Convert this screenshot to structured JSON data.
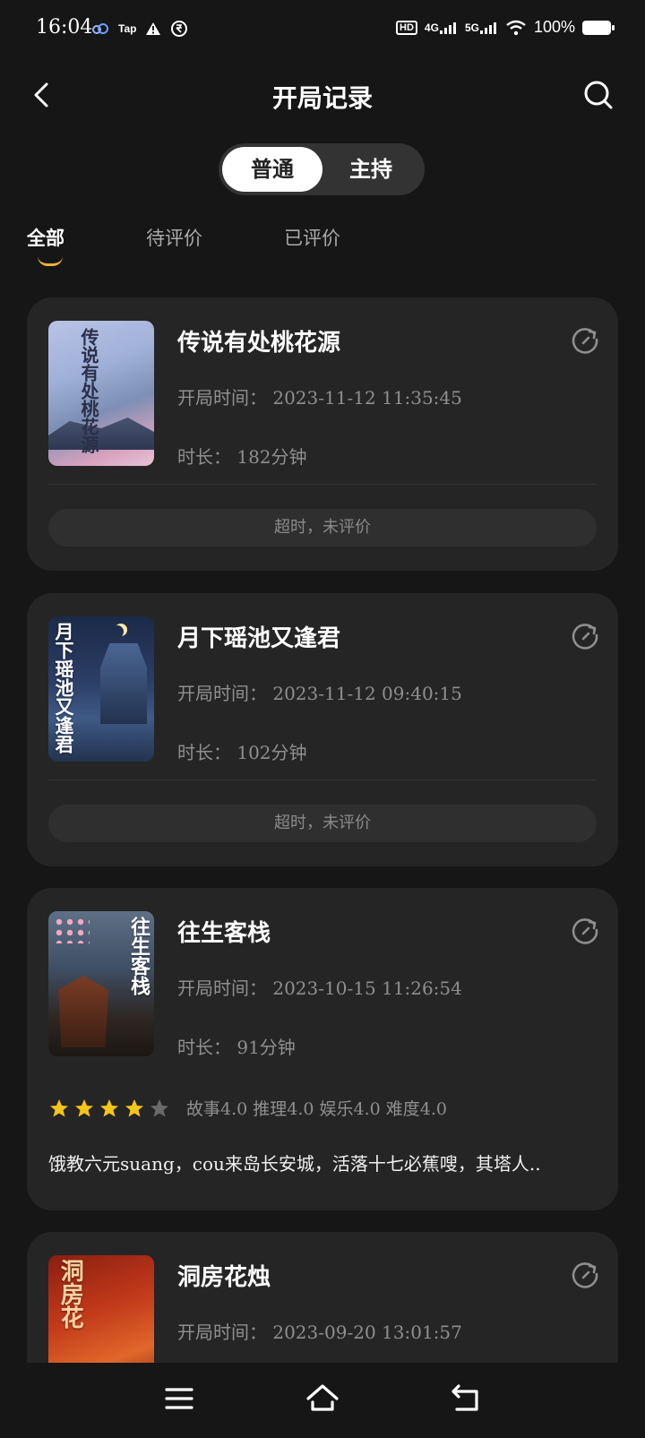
{
  "status_bar": {
    "time": "16:04",
    "left_icons": [
      "cloud-icon",
      "tap-icon",
      "warning-icon",
      "rupee-icon"
    ],
    "tap_text": "Tap",
    "hd_text": "HD",
    "net1": "4G",
    "net2": "5G",
    "battery": "100%"
  },
  "header": {
    "title": "开局记录",
    "back_icon": "chevron-left-icon",
    "search_icon": "search-icon"
  },
  "segment": {
    "options": [
      "普通",
      "主持"
    ],
    "selected": "普通"
  },
  "filter_tabs": {
    "items": [
      "全部",
      "待评价",
      "已评价"
    ],
    "selected": "全部"
  },
  "records": [
    {
      "title": "传说有处桃花源",
      "cover_text": "传说有处桃花源",
      "start_label": "开局时间：",
      "start_time": "2023-11-12 11:35:45",
      "duration_label": "时长：",
      "duration": "182分钟",
      "status": "超时，未评价"
    },
    {
      "title": "月下瑶池又逢君",
      "cover_text": "月下瑶池又逢君",
      "start_label": "开局时间：",
      "start_time": "2023-11-12 09:40:15",
      "duration_label": "时长：",
      "duration": "102分钟",
      "status": "超时，未评价"
    },
    {
      "title": "往生客栈",
      "cover_text": "往生客栈",
      "start_label": "开局时间：",
      "start_time": "2023-10-15 11:26:54",
      "duration_label": "时长：",
      "duration": "91分钟",
      "rating_stars": 4,
      "rating_max": 5,
      "rating_text": "故事4.0 推理4.0 娱乐4.0 难度4.0",
      "review": "饿教六元suang，cou来岛长安城，活落十七必蕉嗖，其塔人.."
    },
    {
      "title": "洞房花烛",
      "cover_text": "洞房花",
      "start_label": "开局时间：",
      "start_time": "2023-09-20 13:01:57"
    }
  ],
  "bottom_nav": {
    "icons": [
      "menu-icon",
      "home-icon",
      "back-icon"
    ]
  },
  "colors": {
    "background": "#161616",
    "card": "#252525",
    "accent_underline": "#f0b23a",
    "star": "#f5c518"
  }
}
